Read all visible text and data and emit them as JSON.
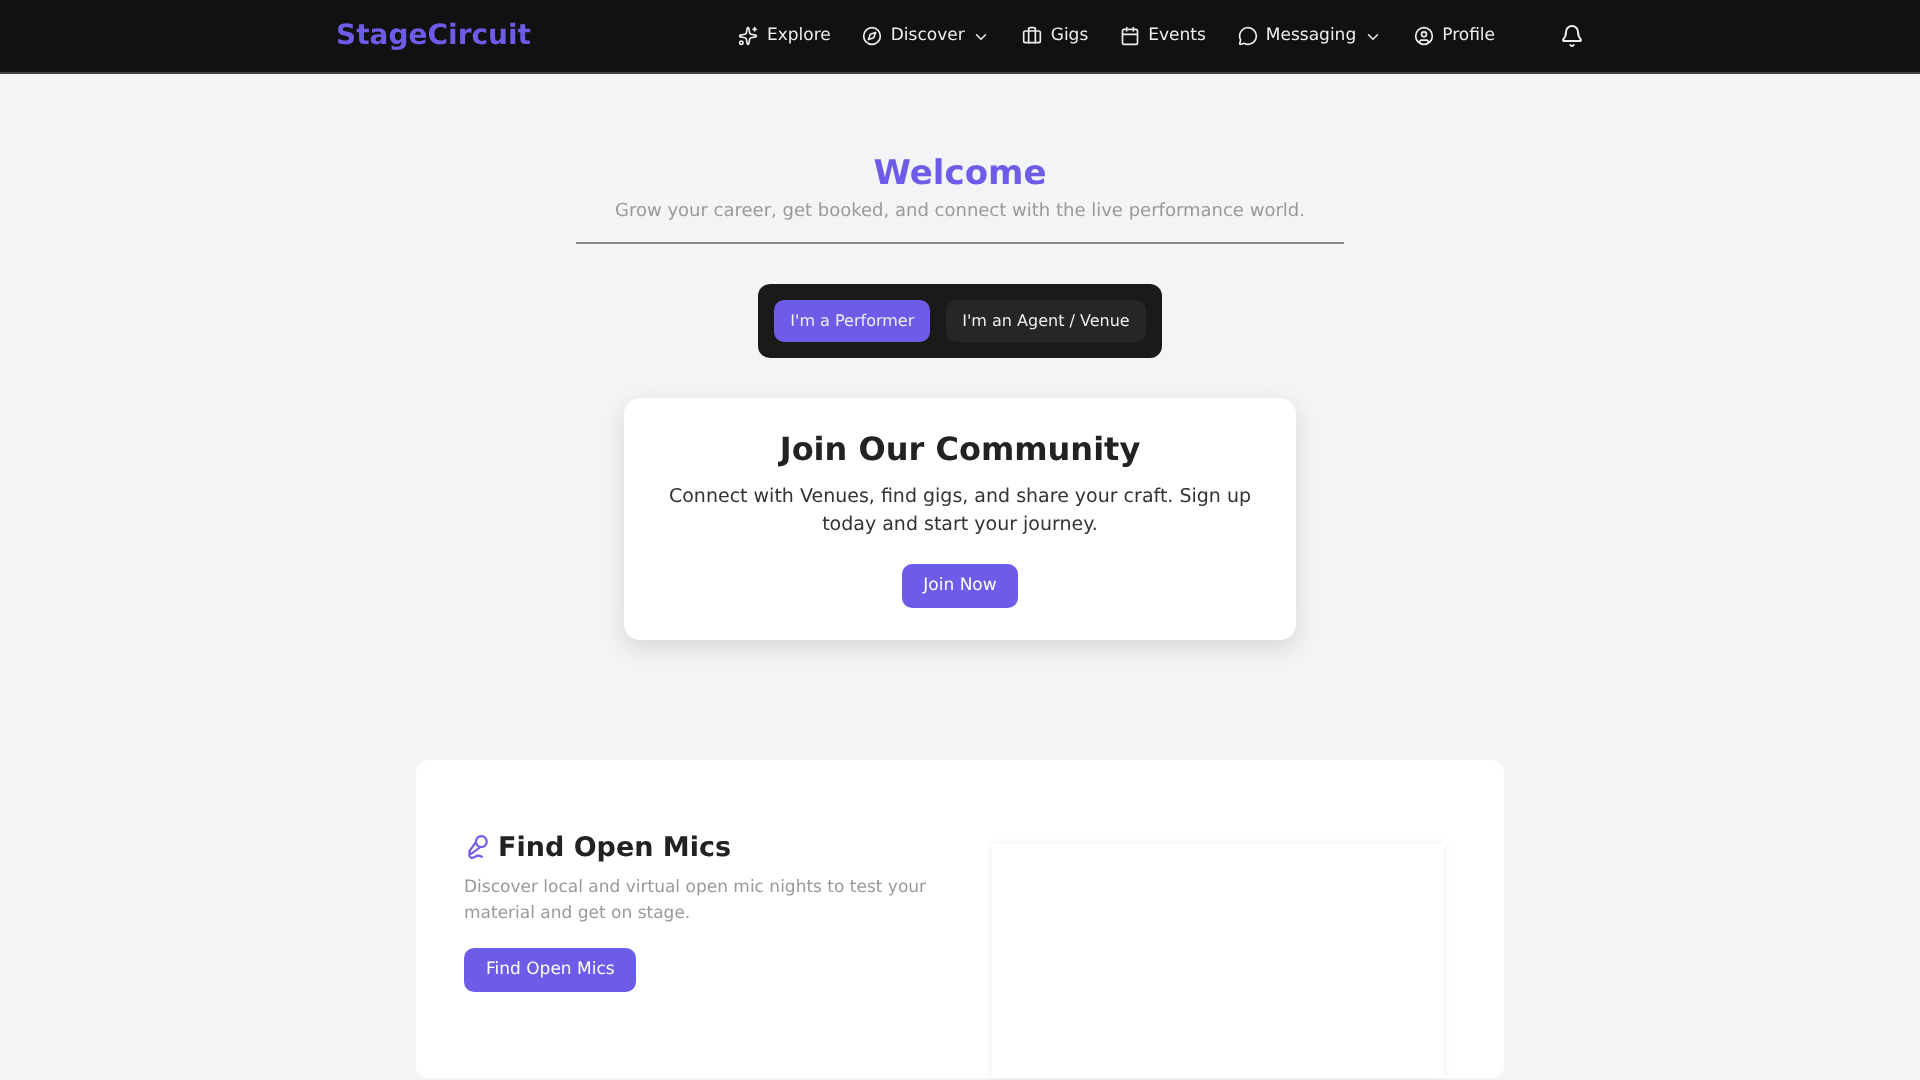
{
  "brand": "StageCircuit",
  "nav": [
    {
      "label": "Explore",
      "kind": "sparkles",
      "dropdown": false
    },
    {
      "label": "Discover",
      "kind": "compass",
      "dropdown": true
    },
    {
      "label": "Gigs",
      "kind": "briefcase",
      "dropdown": false
    },
    {
      "label": "Events",
      "kind": "calendar",
      "dropdown": false
    },
    {
      "label": "Messaging",
      "kind": "message",
      "dropdown": true
    },
    {
      "label": "Profile",
      "kind": "user",
      "dropdown": false
    }
  ],
  "hero": {
    "title": "Welcome",
    "subtitle": "Grow your career, get booked, and connect with the live performance world."
  },
  "roles": [
    {
      "label": "I'm a Performer",
      "selected": true
    },
    {
      "label": "I'm an Agent / Venue",
      "selected": false
    }
  ],
  "community": {
    "title": "Join Our Community",
    "text": "Connect with Venues, find gigs, and share your craft. Sign up today and start your journey.",
    "button": "Join Now"
  },
  "feature": {
    "title": "Find Open Mics",
    "text": "Discover local and virtual open mic nights to test your material and get on stage.",
    "button": "Find Open Mics"
  }
}
